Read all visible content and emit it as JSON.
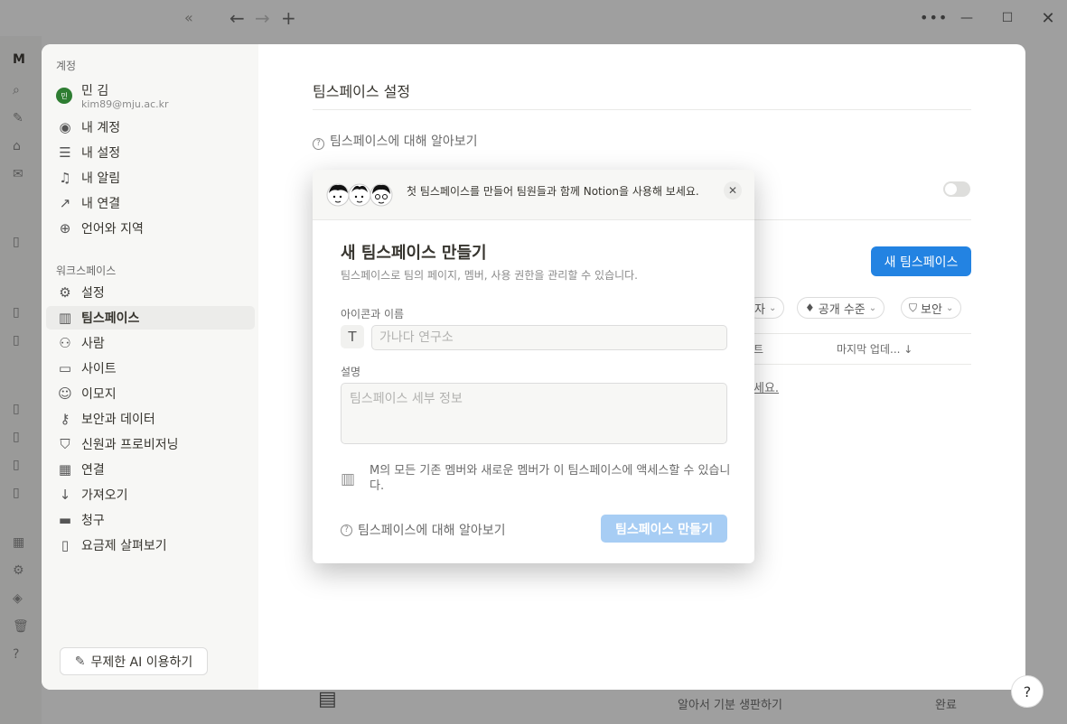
{
  "app": {
    "window_controls": {
      "minimize": "—",
      "maximize": "☐",
      "close": "✕"
    },
    "nav": {
      "collapse": "«",
      "back": "←",
      "forward": "→",
      "new": "+",
      "more": "•••"
    }
  },
  "background": {
    "strip_badge": "M",
    "bottom_text": "알아서 기분 생판하기",
    "bottom_done": "완료"
  },
  "settings": {
    "account_label": "계정",
    "user": {
      "avatar_text": "민",
      "name": "민 김",
      "email": "kim89@mju.ac.kr"
    },
    "account_items": [
      {
        "label": "내 계정",
        "icon": "user-icon"
      },
      {
        "label": "내 설정",
        "icon": "sliders-icon"
      },
      {
        "label": "내 알림",
        "icon": "bell-icon"
      },
      {
        "label": "내 연결",
        "icon": "link-out-icon"
      },
      {
        "label": "언어와 지역",
        "icon": "globe-icon"
      }
    ],
    "workspace_label": "워크스페이스",
    "workspace_items": [
      {
        "label": "설정",
        "icon": "gear-icon"
      },
      {
        "label": "팀스페이스",
        "icon": "building-icon",
        "active": true
      },
      {
        "label": "사람",
        "icon": "people-icon"
      },
      {
        "label": "사이트",
        "icon": "site-icon"
      },
      {
        "label": "이모지",
        "icon": "emoji-icon"
      },
      {
        "label": "보안과 데이터",
        "icon": "key-icon"
      },
      {
        "label": "신원과 프로비저닝",
        "icon": "shield-icon"
      },
      {
        "label": "연결",
        "icon": "grid-icon"
      },
      {
        "label": "가져오기",
        "icon": "download-icon"
      },
      {
        "label": "청구",
        "icon": "card-icon"
      },
      {
        "label": "요금제 살펴보기",
        "icon": "map-icon"
      }
    ],
    "ai_button": "무제한 AI 이용하기",
    "main": {
      "title": "팀스페이스 설정",
      "learn_more": "팀스페이스에 대해 알아보기",
      "new_teamspace_button": "새 팀스페이스",
      "filters": [
        {
          "label": "자",
          "icon": ""
        },
        {
          "label": "공개 수준",
          "icon": "pin-icon"
        },
        {
          "label": "보안",
          "icon": "shield-icon"
        }
      ],
      "column_fragment": "트",
      "column_last_updated": "마지막 업데...",
      "link_fragment": "세요."
    }
  },
  "modal": {
    "banner_text": "첫 팀스페이스를 만들어 팀원들과 함께 Notion을 사용해 보세요.",
    "title": "새 팀스페이스 만들기",
    "subtitle": "팀스페이스로 팀의 페이지, 멤버, 사용 권한을 관리할 수 있습니다.",
    "name_label": "아이콘과 이름",
    "icon_letter": "T",
    "name_placeholder": "가나다 연구소",
    "desc_label": "설명",
    "desc_placeholder": "팀스페이스 세부 정보",
    "access_text": "M의 모든 기존 멤버와 새로운 멤버가 이 팀스페이스에 액세스할 수 있습니다.",
    "learn_more": "팀스페이스에 대해 알아보기",
    "create_button": "팀스페이스 만들기"
  }
}
